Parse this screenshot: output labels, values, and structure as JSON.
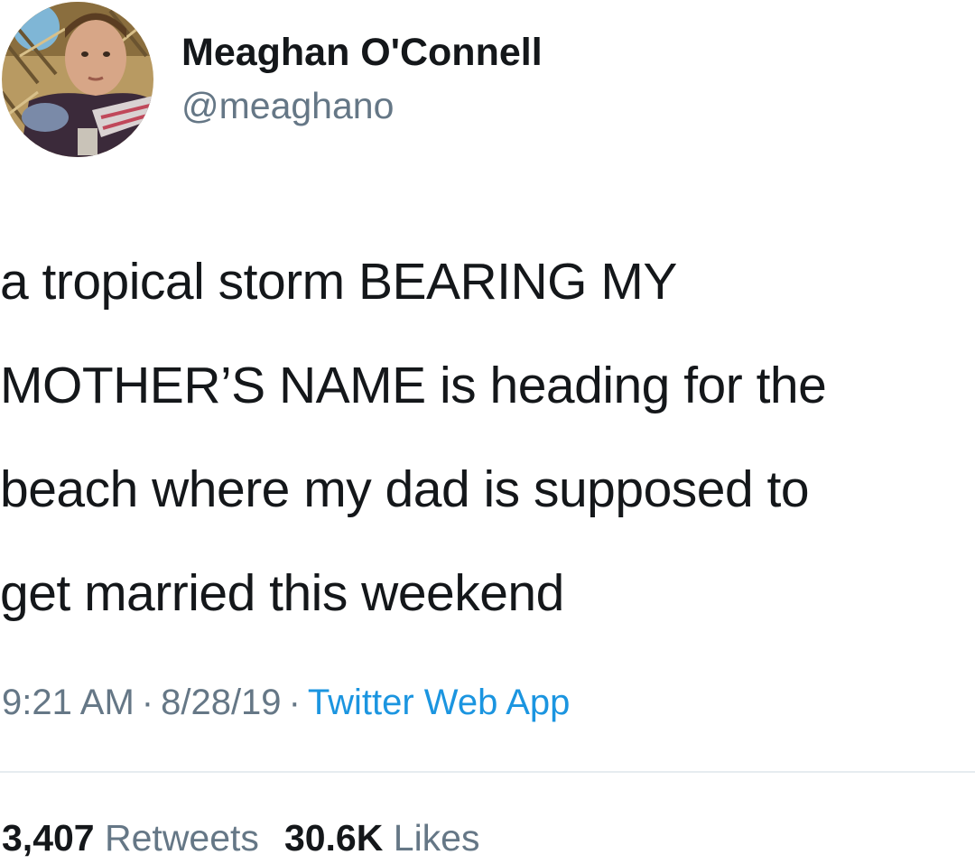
{
  "author": {
    "display_name": "Meaghan O'Connell",
    "handle": "@meaghano",
    "avatar_icon": "profile-photo"
  },
  "tweet": {
    "lines": [
      "a tropical storm BEARING MY",
      "MOTHER’S NAME is heading for the",
      "beach where my dad is supposed to",
      "get married this weekend"
    ],
    "time": "9:21 AM",
    "date": "8/28/19",
    "separator": "·",
    "source": "Twitter Web App"
  },
  "stats": {
    "retweets_count": "3,407",
    "retweets_label": "Retweets",
    "likes_count": "30.6K",
    "likes_label": "Likes"
  },
  "colors": {
    "text": "#14171a",
    "secondary": "#657786",
    "link": "#1b95e0",
    "divider": "#e6ecf0"
  }
}
